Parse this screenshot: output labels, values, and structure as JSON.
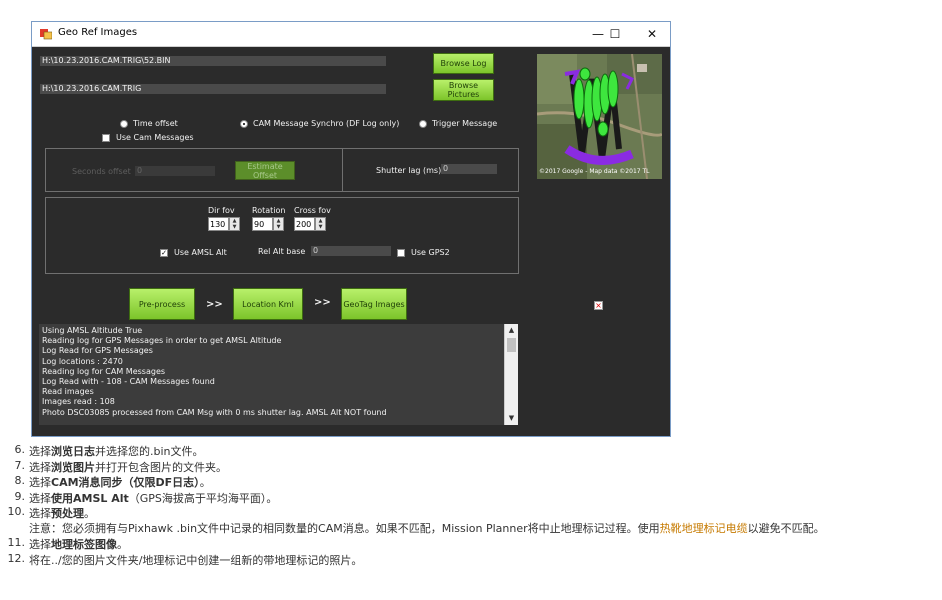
{
  "window": {
    "title": "Geo Ref Images",
    "min_glyph": "—",
    "max_glyph": "☐",
    "close_glyph": "✕"
  },
  "paths": {
    "log_path": "H:\\10.23.2016.CAM.TRIG\\52.BIN",
    "pictures_path": "H:\\10.23.2016.CAM.TRIG"
  },
  "buttons": {
    "browse_log": "Browse Log",
    "browse_pictures": "Browse Pictures",
    "estimate_offset": "Estimate Offset",
    "preprocess": "Pre-process",
    "location_kml": "Location Kml",
    "geotag_images": "GeoTag Images",
    "arrow1": ">>",
    "arrow2": ">>"
  },
  "modes": {
    "time_offset": "Time offset",
    "cam_message_synchro": "CAM Message Synchro (DF Log only)",
    "trigger_message": "Trigger Message",
    "use_cam_messages": "Use Cam Messages",
    "selected": "cam_message_synchro"
  },
  "offset_group": {
    "seconds_offset_label": "Seconds offset",
    "seconds_offset_value": "0",
    "shutter_lag_label": "Shutter lag (ms)",
    "shutter_lag_value": "0"
  },
  "settings": {
    "dir_fov_label": "Dir fov",
    "dir_fov_value": "130",
    "rotation_label": "Rotation",
    "rotation_value": "90",
    "cross_fov_label": "Cross fov",
    "cross_fov_value": "200",
    "use_amsl_alt_label": "Use AMSL Alt",
    "use_amsl_alt_checked": true,
    "rel_alt_base_label": "Rel Alt base",
    "rel_alt_base_value": "0",
    "use_gps2_label": "Use GPS2",
    "use_gps2_checked": false
  },
  "map": {
    "copyright": "©2017 Google - Map data ©2017 TL"
  },
  "log_lines": [
    "Using AMSL Altitude True",
    "Reading log for GPS Messages in order to get AMSL Altitude",
    "Log Read for GPS Messages",
    "Log locations : 2470",
    "Reading log for CAM Messages",
    "Log Read with - 108 - CAM Messages found",
    "Read images",
    "Images read : 108",
    "Photo DSC03085 processed from CAM Msg with 0 ms shutter lag. AMSL Alt NOT found"
  ],
  "instructions": [
    {
      "num": "6.",
      "pre": "选择",
      "bold": "浏览日志",
      "post": "并选择您的.bin文件。"
    },
    {
      "num": "7.",
      "pre": "选择",
      "bold": "浏览图片",
      "post": "并打开包含图片的文件夹。"
    },
    {
      "num": "8.",
      "pre": "选择",
      "bold": "CAM消息同步（仅限DF日志）",
      "post": "。"
    },
    {
      "num": "9.",
      "pre": "选择",
      "bold": "使用AMSL Alt",
      "post": "（GPS海拔高于平均海平面）。"
    },
    {
      "num": "10.",
      "pre": "选择",
      "bold": "预处理",
      "post": "。"
    },
    {
      "num": "11.",
      "pre": "选择",
      "bold": "地理标签图像",
      "post": "。"
    },
    {
      "num": "12.",
      "pre": "将在../您的图片文件夹/地理标记中创建一组新的带地理标记的照片。",
      "bold": "",
      "post": ""
    }
  ],
  "note": {
    "text": "注意：您必须拥有与Pixhawk .bin文件中记录的相同数量的CAM消息。如果不匹配，Mission Planner将中止地理标记过程。使用",
    "link": "热靴地理标记电缆",
    "after": "以避免不匹配。"
  }
}
